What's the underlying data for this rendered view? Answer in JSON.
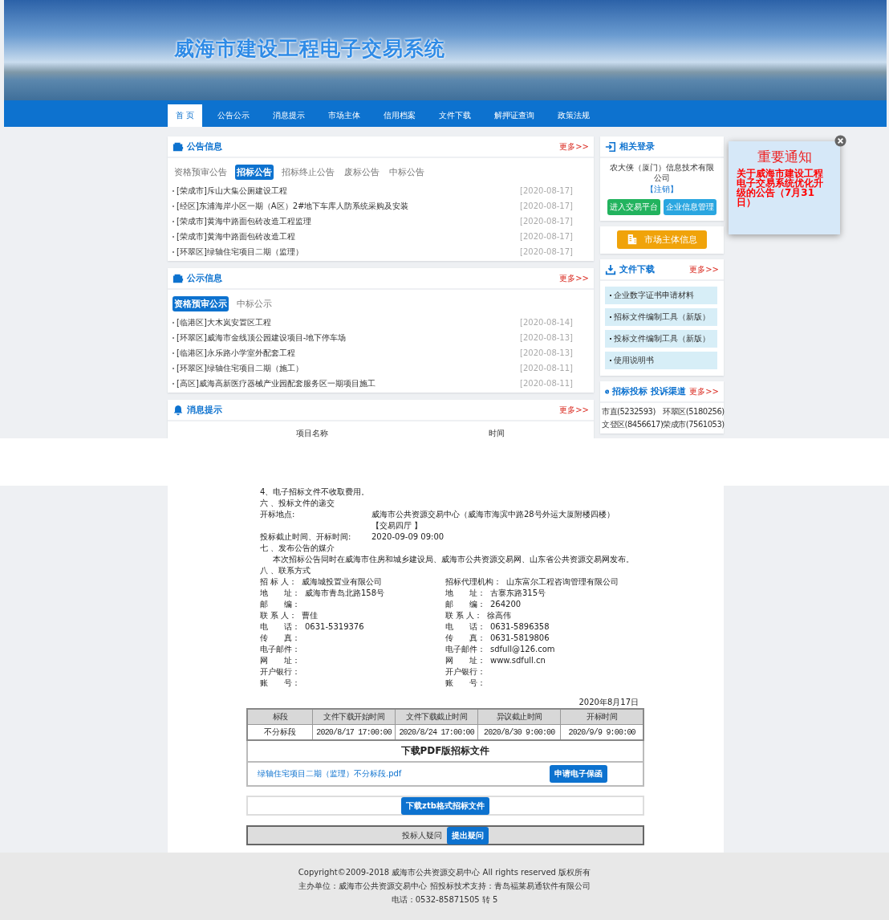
{
  "banner": {
    "title": "威海市建设工程电子交易系统"
  },
  "nav": [
    {
      "label": "首 页",
      "selected": true
    },
    {
      "label": "公告公示",
      "selected": false
    },
    {
      "label": "消息提示",
      "selected": false
    },
    {
      "label": "市场主体",
      "selected": false
    },
    {
      "label": "信用档案",
      "selected": false
    },
    {
      "label": "文件下载",
      "selected": false
    },
    {
      "label": "解押证查询",
      "selected": false
    },
    {
      "label": "政策法规",
      "selected": false
    }
  ],
  "notice_panel": {
    "title": "公告信息",
    "more": "更多>>",
    "tabs": [
      {
        "label": "资格预审公告",
        "selected": false
      },
      {
        "label": "招标公告",
        "selected": true
      },
      {
        "label": "招标终止公告",
        "selected": false
      },
      {
        "label": "废标公告",
        "selected": false
      },
      {
        "label": "中标公告",
        "selected": false
      }
    ],
    "items": [
      {
        "title": "[荣成市]斥山大集公厕建设工程",
        "date": "[2020-08-17]"
      },
      {
        "title": "[经区]东浦海岸小区一期（A区）2#地下车库人防系统采购及安装",
        "date": "[2020-08-17]"
      },
      {
        "title": "[荣成市]黄海中路面包砖改造工程监理",
        "date": "[2020-08-17]"
      },
      {
        "title": "[荣成市]黄海中路面包砖改造工程",
        "date": "[2020-08-17]"
      },
      {
        "title": "[环翠区]绿轴住宅项目二期（监理）",
        "date": "[2020-08-17]"
      }
    ]
  },
  "publicity_panel": {
    "title": "公示信息",
    "more": "更多>>",
    "tabs": [
      {
        "label": "资格预审公示",
        "selected": true
      },
      {
        "label": "中标公示",
        "selected": false
      }
    ],
    "items": [
      {
        "title": "[临港区]大木岚安置区工程",
        "date": "[2020-08-14]"
      },
      {
        "title": "[环翠区]威海市金线顶公园建设项目-地下停车场",
        "date": "[2020-08-13]"
      },
      {
        "title": "[临港区]永乐路小学室外配套工程",
        "date": "[2020-08-13]"
      },
      {
        "title": "[环翠区]绿轴住宅项目二期（施工）",
        "date": "[2020-08-11]"
      },
      {
        "title": "[高区]威海高新医疗器械产业园配套服务区一期项目施工",
        "date": "[2020-08-11]"
      }
    ]
  },
  "message_panel": {
    "title": "消息提示",
    "more": "更多>>",
    "columns": [
      "项目名称",
      "时间"
    ]
  },
  "login_panel": {
    "title": "相关登录",
    "company": "农大侠（厦门）信息技术有限公司",
    "logout": "【注销】",
    "buttons": [
      {
        "label": "进入交易平台",
        "color": "#22b35e"
      },
      {
        "label": "企业信息管理",
        "color": "#2aa6e0"
      }
    ]
  },
  "market_button": {
    "label": "市场主体信息"
  },
  "downloads_panel": {
    "title": "文件下载",
    "more": "更多>>",
    "items": [
      "企业数字证书申请材料",
      "招标文件编制工具（新版）",
      "投标文件编制工具（新版）",
      "使用说明书"
    ]
  },
  "complaint_panel": {
    "title": "招标投标 投诉渠道",
    "more": "更多>>",
    "contacts": [
      "市直(5232593)",
      "环翠区(5180256)",
      "文登区(8456617)",
      "荣成市(7561053)"
    ]
  },
  "popup": {
    "heading": "重要通知",
    "message": "关于威海市建设工程电子交易系统优化升级的公告（7月31日）"
  },
  "document": {
    "lines": [
      {
        "kind": "text",
        "text": "4、电子招标文件不收取费用。"
      },
      {
        "kind": "text",
        "text": "六 、投标文件的递交"
      },
      {
        "kind": "field",
        "label": "开标地点:",
        "value": "威海市公共资源交易中心（威海市海滨中路28号外运大厦附楼四楼）"
      },
      {
        "kind": "field",
        "value": "【交易四厅 】"
      },
      {
        "kind": "field",
        "label": "投标截止时间、开标时间:",
        "value": "2020-09-09 09:00"
      },
      {
        "kind": "text",
        "text": "七 、发布公告的媒介"
      },
      {
        "kind": "indent",
        "text": "本次招标公告同时在威海市住房和城乡建设局、威海市公共资源交易网、山东省公共资源交易网发布。"
      },
      {
        "kind": "text",
        "text": "八 、联系方式"
      }
    ],
    "contacts": [
      [
        {
          "label": "招 标 人：",
          "value": "威海城投置业有限公司"
        },
        {
          "label": "招标代理机构：",
          "value": "山东富尔工程咨询管理有限公司"
        }
      ],
      [
        {
          "label": "地　　址：",
          "value": "威海市青岛北路158号"
        },
        {
          "label": "地　　址：",
          "value": "古寨东路315号"
        }
      ],
      [
        {
          "label": "邮　　编："
        },
        {
          "label": "邮　　编：",
          "value": "264200"
        }
      ],
      [
        {
          "label": "联 系 人：",
          "value": "曹佳"
        },
        {
          "label": "联 系 人：",
          "value": "徐高伟"
        }
      ],
      [
        {
          "label": "电　　话：",
          "value": "0631-5319376"
        },
        {
          "label": "电　　话：",
          "value": "0631-5896358"
        }
      ],
      [
        {
          "label": "传　　真："
        },
        {
          "label": "传　　真：",
          "value": "0631-5819806"
        }
      ],
      [
        {
          "label": "电子邮件："
        },
        {
          "label": "电子邮件：",
          "value": "sdfull@126.com"
        }
      ],
      [
        {
          "label": "网　　址："
        },
        {
          "label": "网　　址：",
          "value": "www.sdfull.cn"
        }
      ],
      [
        {
          "label": "开户银行："
        },
        {
          "label": "开户银行："
        }
      ],
      [
        {
          "label": "账　　号："
        },
        {
          "label": "账　　号："
        }
      ]
    ],
    "date": "2020年8月17日"
  },
  "schedule": {
    "columns": [
      "标段",
      "文件下载开始时间",
      "文件下载截止时间",
      "异议截止时间",
      "开标时间"
    ],
    "rows": [
      [
        "不分标段",
        "2020/8/17 17:00:00",
        "2020/8/24 17:00:00",
        "2020/8/30 9:00:00",
        "2020/9/9 9:00:00"
      ]
    ]
  },
  "pdf": {
    "title": "下载PDF版招标文件",
    "file": "绿轴住宅项目二期（监理）不分标段.pdf",
    "button": "申请电子保函"
  },
  "ztb_button": "下载ztb格式招标文件",
  "question": {
    "label": "投标人疑问",
    "button": "提出疑问"
  },
  "footer": [
    "Copyright©2009-2018 威海市公共资源交易中心 All rights reserved 版权所有",
    "主办单位：威海市公共资源交易中心 招投标技术支持：青岛福莱易通软件有限公司",
    "电话：0532-85871505 转 5"
  ]
}
